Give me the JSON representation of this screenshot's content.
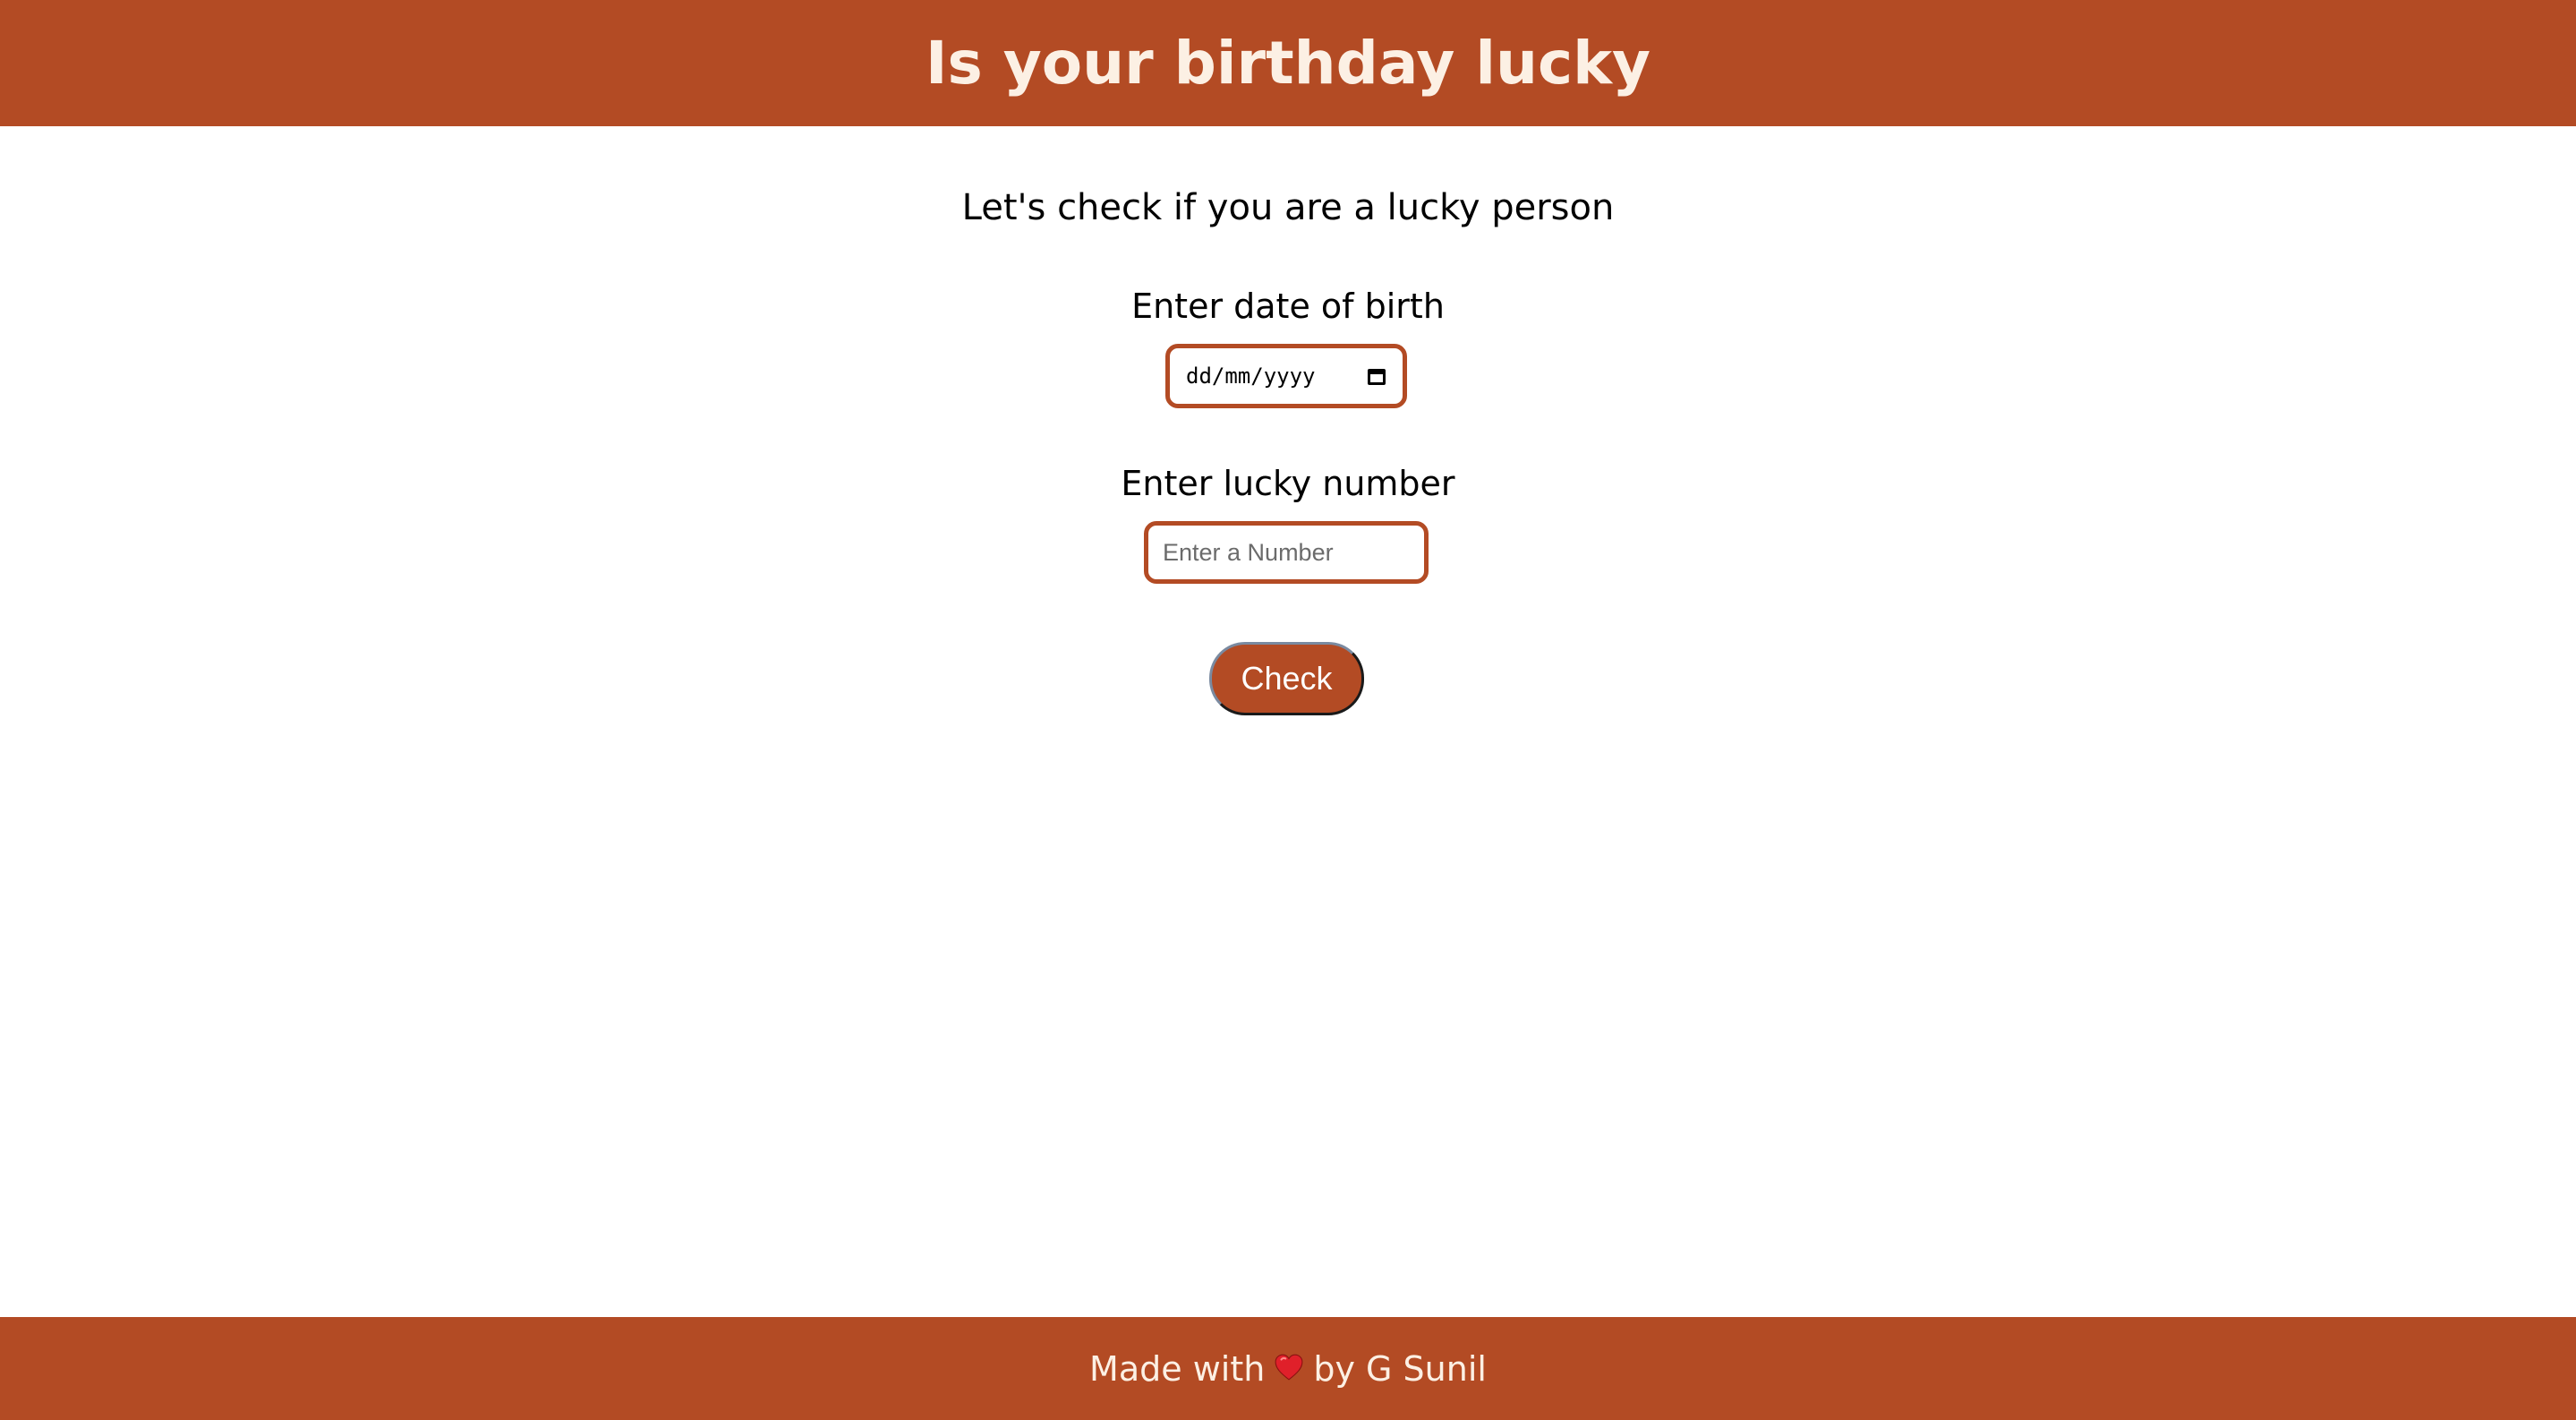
{
  "header": {
    "title": "Is your birthday lucky"
  },
  "main": {
    "subtitle": "Let's check if you are a lucky person",
    "dob_label": "Enter date of birth",
    "dob_placeholder": "dd/mm/yyyy",
    "lucky_label": "Enter lucky number",
    "lucky_placeholder": "Enter a Number",
    "check_label": "Check"
  },
  "footer": {
    "text_before": "Made with",
    "heart_icon": "heart-icon",
    "text_after": "by G Sunil"
  },
  "colors": {
    "brand": "#B34B24",
    "header_text": "#FCF0E4",
    "heart": "#E0202A"
  }
}
